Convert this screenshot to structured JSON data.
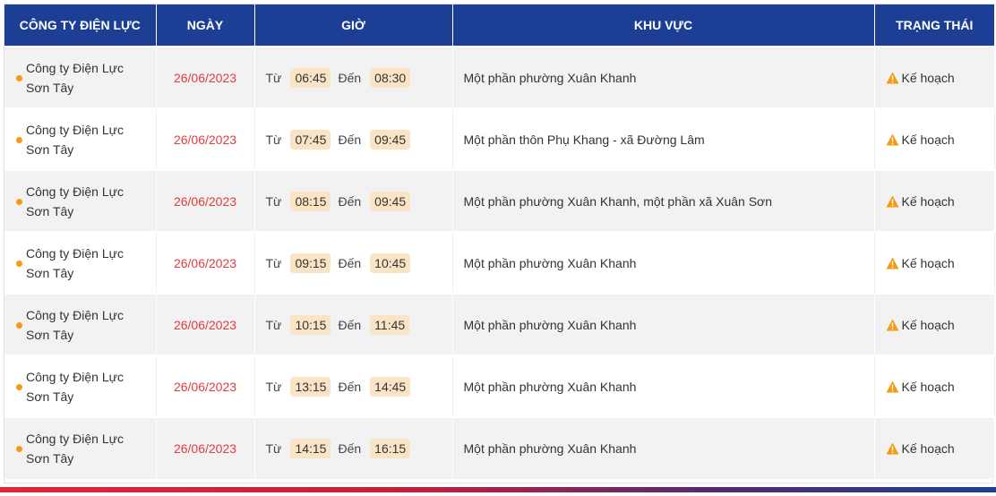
{
  "headers": {
    "company": "CÔNG TY ĐIỆN LỰC",
    "date": "NGÀY",
    "time": "GIỜ",
    "area": "KHU VỰC",
    "status": "TRẠNG THÁI"
  },
  "labels": {
    "from": "Từ",
    "to": "Đến"
  },
  "colors": {
    "header_bg": "#1c3f95",
    "date_text": "#e03c3c",
    "status_icon": "#f39c12",
    "time_pill": "#fbe4c6"
  },
  "status_icon": "warning-triangle-icon",
  "rows": [
    {
      "company_line1": "Công ty Điện Lực",
      "company_line2": "Sơn Tây",
      "date": "26/06/2023",
      "from": "06:45",
      "to": "08:30",
      "area": "Một phần phường Xuân Khanh",
      "status": "Kế hoạch"
    },
    {
      "company_line1": "Công ty Điện Lực",
      "company_line2": "Sơn Tây",
      "date": "26/06/2023",
      "from": "07:45",
      "to": "09:45",
      "area": "Một phần thôn Phụ Khang - xã Đường Lâm",
      "status": "Kế hoạch"
    },
    {
      "company_line1": "Công ty Điện Lực",
      "company_line2": "Sơn Tây",
      "date": "26/06/2023",
      "from": "08:15",
      "to": "09:45",
      "area": "Một phần phường Xuân Khanh, một phần xã Xuân Sơn",
      "status": "Kế hoạch"
    },
    {
      "company_line1": "Công ty Điện Lực",
      "company_line2": "Sơn Tây",
      "date": "26/06/2023",
      "from": "09:15",
      "to": "10:45",
      "area": "Một phần phường Xuân Khanh",
      "status": "Kế hoạch"
    },
    {
      "company_line1": "Công ty Điện Lực",
      "company_line2": "Sơn Tây",
      "date": "26/06/2023",
      "from": "10:15",
      "to": "11:45",
      "area": "Một phần phường Xuân Khanh",
      "status": "Kế hoạch"
    },
    {
      "company_line1": "Công ty Điện Lực",
      "company_line2": "Sơn Tây",
      "date": "26/06/2023",
      "from": "13:15",
      "to": "14:45",
      "area": "Một phần phường Xuân Khanh",
      "status": "Kế hoạch"
    },
    {
      "company_line1": "Công ty Điện Lực",
      "company_line2": "Sơn Tây",
      "date": "26/06/2023",
      "from": "14:15",
      "to": "16:15",
      "area": "Một phần phường Xuân Khanh",
      "status": "Kế hoạch"
    }
  ]
}
